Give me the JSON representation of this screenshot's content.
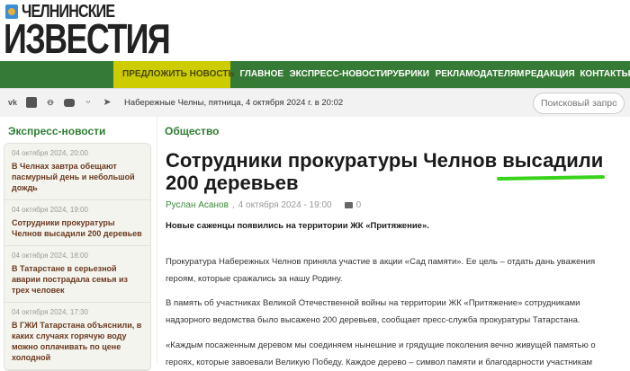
{
  "logo": {
    "line1": "ЧЕЛНИНСКИЕ",
    "line2": "ИЗВЕСТИЯ"
  },
  "nav": {
    "propose": "ПРЕДЛОЖИТЬ НОВОСТЬ",
    "items": [
      "ГЛАВНОЕ",
      "ЭКСПРЕСС-НОВОСТИ",
      "РУБРИКИ",
      "РЕКЛАМОДАТЕЛЯМ",
      "РЕДАКЦИЯ",
      "КОНТАКТЫ"
    ]
  },
  "toolbar": {
    "social": [
      "vk-icon",
      "vk-alt-icon",
      "odnoklassniki-icon",
      "youtube-icon",
      "dzen-icon",
      "telegram-icon"
    ],
    "date": "Набережные Челны, пятница, 4 октября 2024 г. в 20:02",
    "search_placeholder": "Поисковый запрос"
  },
  "sidebar": {
    "heading": "Экспресс-новости",
    "items": [
      {
        "time": "04 октября 2024, 20:00",
        "title": "В Челнах завтра обещают пасмурный день и небольшой дождь"
      },
      {
        "time": "04 октября 2024, 19:00",
        "title": "Сотрудники прокуратуры Челнов высадили 200 деревьев"
      },
      {
        "time": "04 октября 2024, 18:00",
        "title": "В Татарстане в серьезной аварии пострадала семья из трех человек"
      },
      {
        "time": "04 октября 2024, 17:30",
        "title": "В ГЖИ Татарстана объяснили, в каких случаях горячую воду можно оплачивать по цене холодной"
      }
    ]
  },
  "article": {
    "section": "Общество",
    "title": "Сотрудники прокуратуры Челнов высадили 200 деревьев",
    "author": "Руслан Асанов",
    "date": "4 октября 2024 - 19:00",
    "comments": "0",
    "lead": "Новые саженцы появились на территории ЖК «Притяжение».",
    "paragraphs": [
      "Прокуратура Набережных Челнов приняла участие в акции «Сад памяти». Ее цель – отдать дань уважения героям, которые сражались за нашу Родину.",
      "В память об участниках Великой Отечественной войны на территории ЖК «Притяжение» сотрудниками надзорного ведомства было высажено 200 деревьев, сообщает пресс-служба прокуратуры Татарстана.",
      "«Каждым посаженным деревом мы соединяем нынешние и грядущие поколения вечно живущей памятью о героях, которые завоевали Великую Победу. Каждое дерево – символ памяти и благодарности участникам"
    ]
  }
}
